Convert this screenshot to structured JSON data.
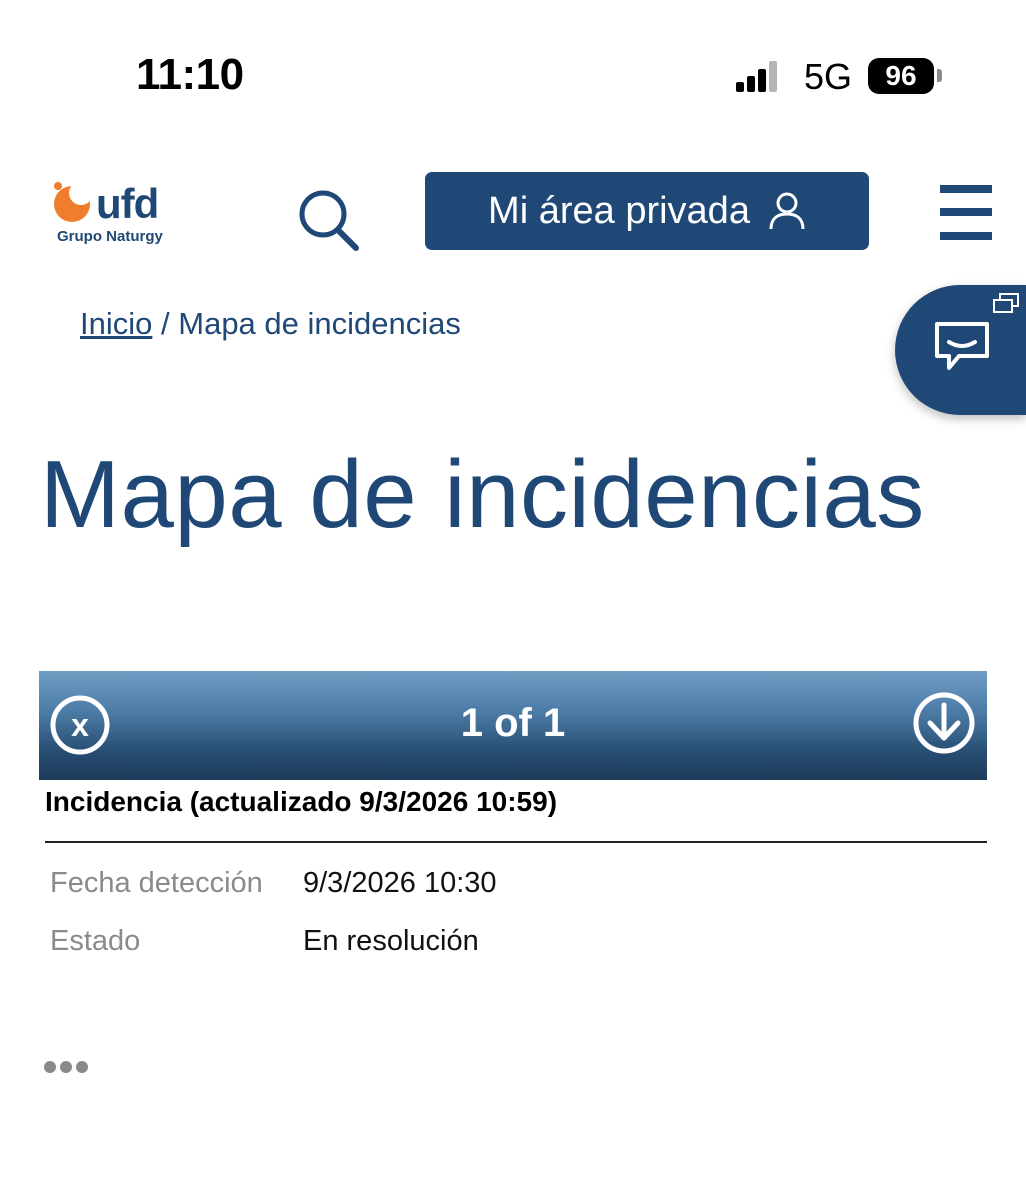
{
  "status_bar": {
    "time": "11:10",
    "network": "5G",
    "battery": "96"
  },
  "header": {
    "logo_text": "ufd",
    "logo_subtitle": "Grupo Naturgy",
    "private_area_label": "Mi área privada",
    "icons": [
      "search-icon",
      "user-icon",
      "hamburger-menu-icon",
      "chat-icon"
    ]
  },
  "breadcrumb": {
    "home": "Inicio",
    "separator": "/",
    "current": "Mapa de incidencias"
  },
  "page": {
    "title": "Mapa de incidencias"
  },
  "popup": {
    "counter": "1 of 1",
    "incident_title": "Incidencia (actualizado 9/3/2026 10:59)",
    "rows": [
      {
        "label": "Fecha detección",
        "value": "9/3/2026 10:30"
      },
      {
        "label": "Estado",
        "value": "En resolución"
      }
    ]
  },
  "colors": {
    "brand_blue": "#1f4877",
    "logo_orange": "#ef7d2b"
  }
}
